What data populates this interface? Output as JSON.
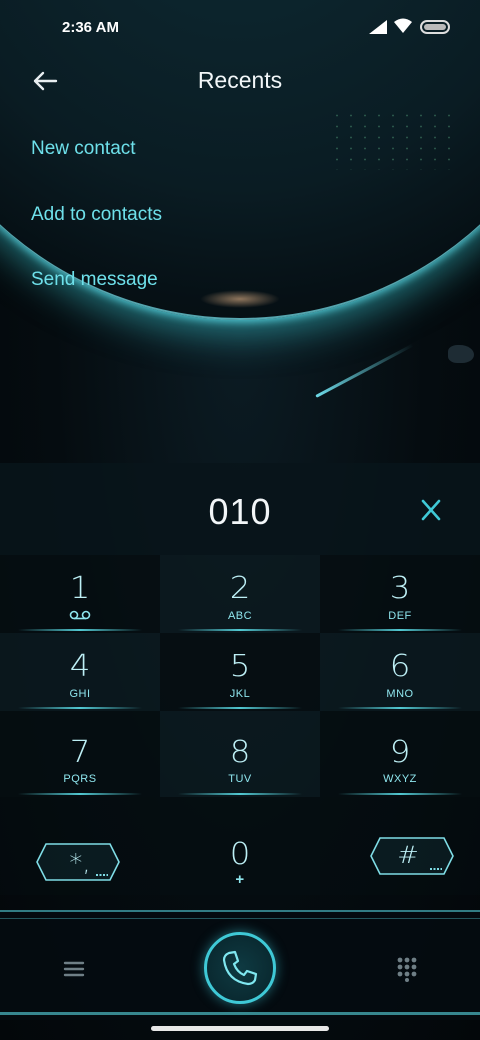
{
  "status_bar": {
    "time": "2:36 AM"
  },
  "header": {
    "title": "Recents"
  },
  "menu": {
    "items": [
      {
        "label": "New contact"
      },
      {
        "label": "Add to contacts"
      },
      {
        "label": "Send message"
      }
    ]
  },
  "dialer": {
    "number": "010"
  },
  "keypad": {
    "keys": [
      {
        "digit": "1",
        "letters": ""
      },
      {
        "digit": "2",
        "letters": "ABC"
      },
      {
        "digit": "3",
        "letters": "DEF"
      },
      {
        "digit": "4",
        "letters": "GHI"
      },
      {
        "digit": "5",
        "letters": "JKL"
      },
      {
        "digit": "6",
        "letters": "MNO"
      },
      {
        "digit": "7",
        "letters": "PQRS"
      },
      {
        "digit": "8",
        "letters": "TUV"
      },
      {
        "digit": "9",
        "letters": "WXYZ"
      },
      {
        "digit": "*,",
        "letters": ""
      },
      {
        "digit": "0",
        "letters": "+"
      },
      {
        "digit": "#",
        "letters": ""
      }
    ]
  },
  "colors": {
    "accent": "#6ee0ea",
    "glow": "#3fc9d6",
    "background": "#050c10"
  }
}
